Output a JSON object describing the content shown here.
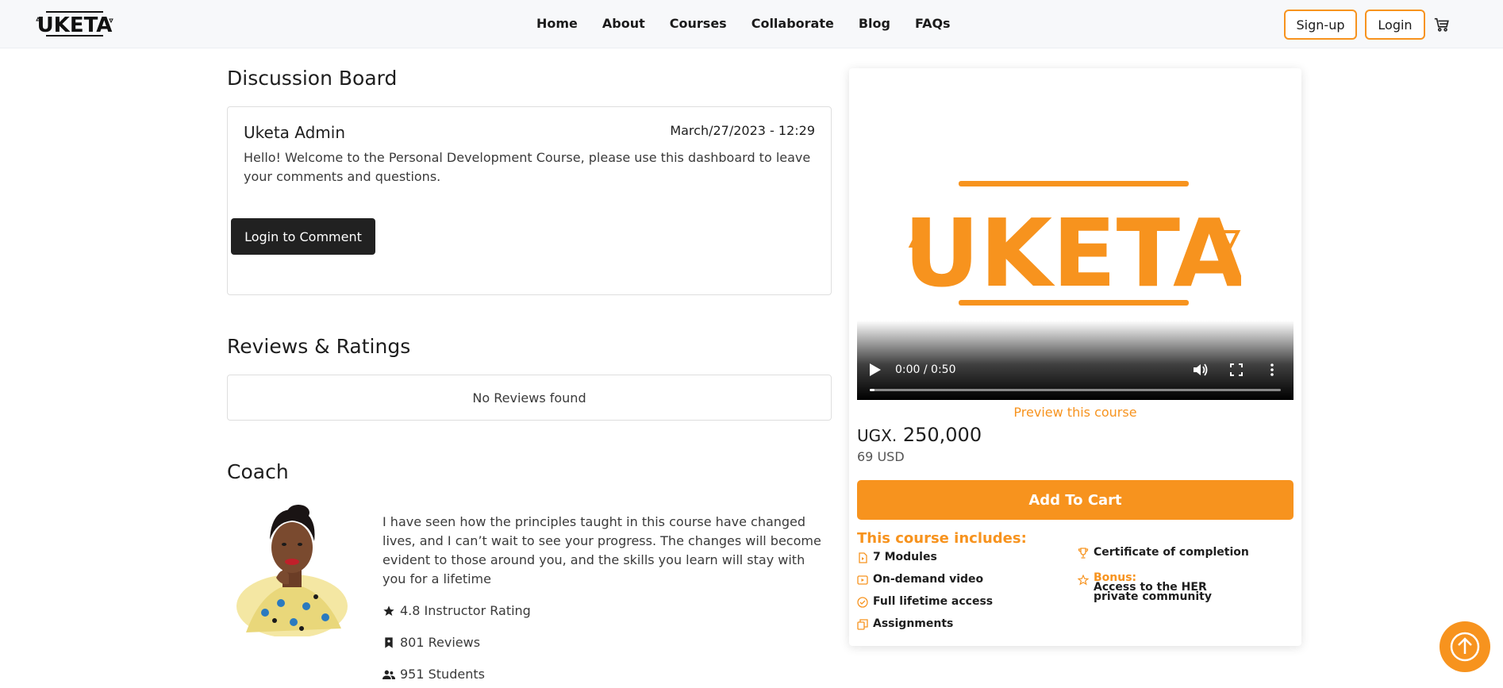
{
  "nav": {
    "logo_text": "UKETA",
    "links": [
      "Home",
      "About",
      "Courses",
      "Collaborate",
      "Blog",
      "FAQs"
    ],
    "signup_label": "Sign-up",
    "login_label": "Login"
  },
  "discussion": {
    "title": "Discussion Board",
    "author": "Uketa Admin",
    "date": "March/27/2023 - 12:29",
    "message": "Hello! Welcome to the Personal Development Course, please use this dashboard to leave your comments and questions.",
    "button_label": "Login to Comment"
  },
  "reviews": {
    "title": "Reviews & Ratings",
    "empty_text": "No Reviews found"
  },
  "coach": {
    "title": "Coach",
    "quote": "I have seen how the principles taught in this course have changed lives, and I can’t wait to see your progress. The changes will become evident to those around you, and the skills you learn will stay with you for a lifetime",
    "rating": "4.8 Instructor Rating",
    "reviews": "801 Reviews",
    "students": "951 Students"
  },
  "course": {
    "video_logo_text": "UKETA",
    "video_time": "0:00 / 0:50",
    "video_progress": 0.0,
    "preview_label": "Preview this course",
    "price_currency": "UGX.",
    "price_amount": "250,000",
    "price_usd": "69 USD",
    "add_to_cart_label": "Add To Cart",
    "includes_title": "This course includes:",
    "includes": [
      "7 Modules",
      "On-demand video",
      "Full lifetime access",
      "Assignments",
      "Certificate of completion"
    ],
    "bonus_label": "Bonus:",
    "bonus_text": "Access to the HER private community"
  },
  "colors": {
    "accent": "#f7931e",
    "dark_button": "#212121"
  },
  "icons": [
    "cart-icon",
    "star-icon",
    "bookmark-icon",
    "users-icon",
    "play-icon",
    "volume-icon",
    "fullscreen-icon",
    "more-icon",
    "file-icon",
    "video-icon",
    "check-circle-icon",
    "copy-icon",
    "trophy-icon",
    "star-outline-icon",
    "arrow-up-icon"
  ]
}
